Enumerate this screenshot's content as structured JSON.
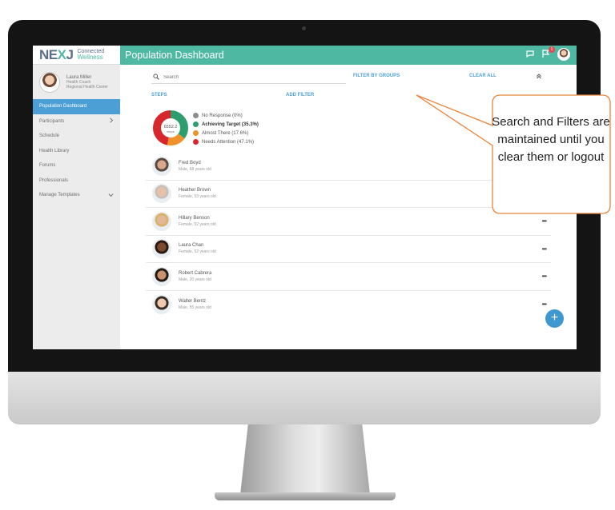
{
  "app": {
    "logo_mark": "NE",
    "logo_mark_x": "X",
    "logo_mark_tail": "J",
    "logo_line1": "Connected",
    "logo_line2": "Wellness",
    "page_title": "Population Dashboard",
    "notification_count": "1"
  },
  "profile": {
    "name": "Laura Miller",
    "role": "Health Coach",
    "org": "Regional Health Center"
  },
  "sidebar": {
    "items": [
      {
        "label": "Population Dashboard",
        "active": true,
        "chevron": ""
      },
      {
        "label": "Participants",
        "active": false,
        "chevron": ">"
      },
      {
        "label": "Schedule",
        "active": false,
        "chevron": ""
      },
      {
        "label": "Health Library",
        "active": false,
        "chevron": ""
      },
      {
        "label": "Forums",
        "active": false,
        "chevron": ""
      },
      {
        "label": "Professionals",
        "active": false,
        "chevron": ""
      },
      {
        "label": "Manage Templates",
        "active": false,
        "chevron": "v"
      }
    ]
  },
  "toolbar": {
    "search_placeholder": "Search",
    "filter_by_groups": "FILTER BY GROUPS",
    "clear_all": "CLEAR ALL",
    "steps": "STEPS",
    "add_filter": "ADD FILTER"
  },
  "summary": {
    "value": "6552.2",
    "unit": "steps",
    "legend": [
      {
        "label": "No Response (0%)",
        "color": "#8c8c8c",
        "percent": 0
      },
      {
        "label": "Achieving Target (35.3%)",
        "color": "#2e9e6e",
        "percent": 35.3
      },
      {
        "label": "Almost There (17.6%)",
        "color": "#f0922b",
        "percent": 17.6
      },
      {
        "label": "Needs Attention (47.1%)",
        "color": "#d7262c",
        "percent": 47.1
      }
    ]
  },
  "participants": [
    {
      "name": "Fred Boyd",
      "meta": "Male, 68 years old",
      "more": ""
    },
    {
      "name": "Heather Brown",
      "meta": "Female, 53 years old",
      "more": ""
    },
    {
      "name": "Hillary Benson",
      "meta": "Female, 52 years old",
      "more": "•••"
    },
    {
      "name": "Laura Chan",
      "meta": "Female, 52 years old",
      "more": "•••"
    },
    {
      "name": "Robert Cabrera",
      "meta": "Male, 20 years old",
      "more": "•••"
    },
    {
      "name": "Walter Bentz",
      "meta": "Male, 55 years old",
      "more": "•••"
    }
  ],
  "fab_label": "+",
  "callout": {
    "text": "Search and Filters are maintained until you clear them or logout"
  },
  "colors": {
    "brand_teal": "#4fb8a3",
    "accent_blue": "#4b9fd4",
    "callout_border": "#e8843c"
  }
}
